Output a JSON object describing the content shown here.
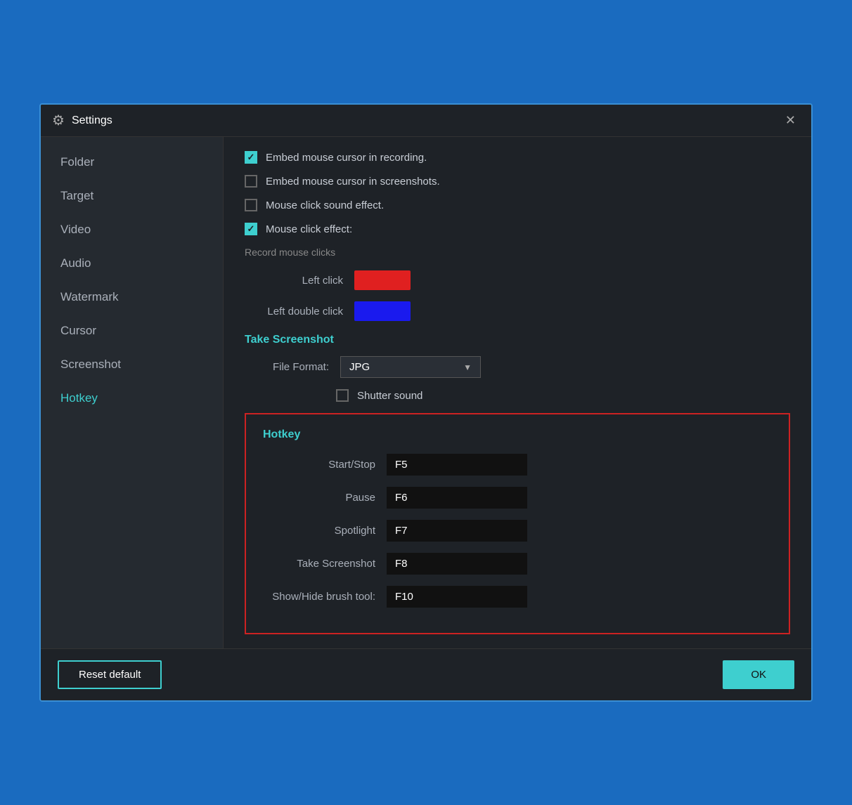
{
  "window": {
    "title": "Settings",
    "close_label": "✕"
  },
  "sidebar": {
    "items": [
      {
        "label": "Folder",
        "active": false
      },
      {
        "label": "Target",
        "active": false
      },
      {
        "label": "Video",
        "active": false
      },
      {
        "label": "Audio",
        "active": false
      },
      {
        "label": "Watermark",
        "active": false
      },
      {
        "label": "Cursor",
        "active": false
      },
      {
        "label": "Screenshot",
        "active": false
      },
      {
        "label": "Hotkey",
        "active": true
      }
    ]
  },
  "main": {
    "checkboxes": [
      {
        "label": "Embed mouse cursor in recording.",
        "checked": true
      },
      {
        "label": "Embed mouse cursor in screenshots.",
        "checked": false
      },
      {
        "label": "Mouse click sound effect.",
        "checked": false
      },
      {
        "label": "Mouse click effect:",
        "checked": true
      }
    ],
    "record_mouse_clicks_label": "Record mouse clicks",
    "left_click_label": "Left click",
    "left_double_click_label": "Left double click",
    "take_screenshot_title": "Take Screenshot",
    "file_format_label": "File Format:",
    "file_format_value": "JPG",
    "shutter_sound_label": "Shutter sound",
    "hotkey_title": "Hotkey",
    "hotkeys": [
      {
        "label": "Start/Stop",
        "value": "F5"
      },
      {
        "label": "Pause",
        "value": "F6"
      },
      {
        "label": "Spotlight",
        "value": "F7"
      },
      {
        "label": "Take Screenshot",
        "value": "F8"
      },
      {
        "label": "Show/Hide brush tool:",
        "value": "F10"
      }
    ],
    "reset_label": "Reset default",
    "ok_label": "OK"
  },
  "colors": {
    "accent": "#3ecfcf",
    "left_click": "#e02020",
    "left_double_click": "#1a1aee",
    "hotkey_border": "#cc2222"
  }
}
